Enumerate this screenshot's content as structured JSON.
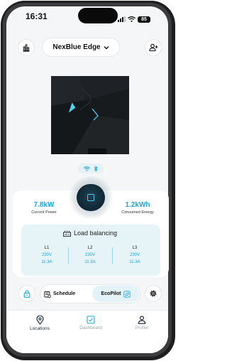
{
  "status_bar": {
    "time": "16:31",
    "battery": "85"
  },
  "header": {
    "device_name": "NexBlue Edge"
  },
  "connectivity": {
    "wifi": "wifi-icon",
    "bluetooth": "bluetooth-icon"
  },
  "stats": {
    "current_power": {
      "value": "7.8kW",
      "label": "Current Power"
    },
    "consumed_energy": {
      "value": "1.2kWh",
      "label": "Consumed Energy"
    }
  },
  "load_balancing": {
    "title": "Load balancing",
    "phases": [
      {
        "name": "L1",
        "voltage": "230V",
        "current": "11.3A"
      },
      {
        "name": "L2",
        "voltage": "230V",
        "current": "11.3A"
      },
      {
        "name": "L3",
        "voltage": "230V",
        "current": "11.3A"
      }
    ]
  },
  "controls": {
    "schedule": "Schedule",
    "ecopilot": "EcoPilot"
  },
  "nav": [
    {
      "label": "Locations",
      "active": true
    },
    {
      "label": "Dashboard",
      "active": false
    },
    {
      "label": "Profile",
      "active": false
    }
  ],
  "colors": {
    "accent": "#1aa7d8",
    "panel": "#e6f4f8",
    "dark": "#0f2733"
  }
}
